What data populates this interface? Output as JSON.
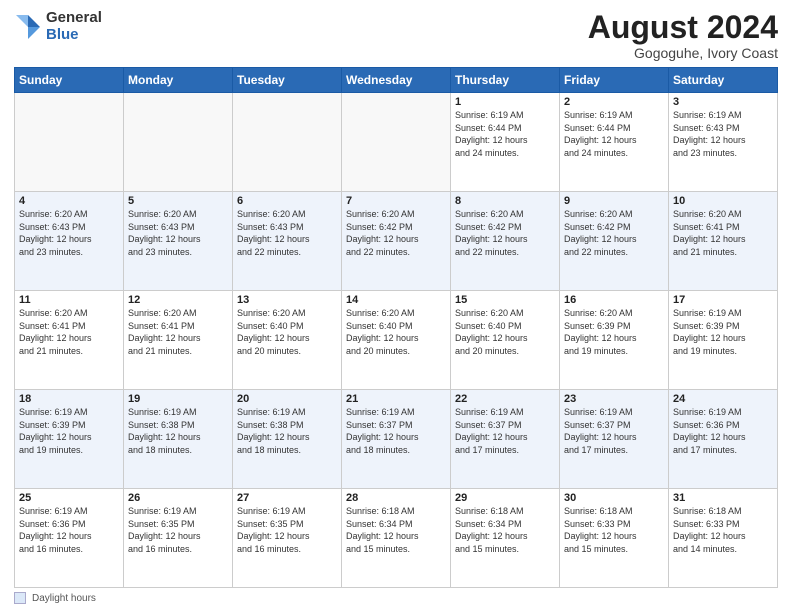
{
  "logo": {
    "general": "General",
    "blue": "Blue"
  },
  "title": "August 2024",
  "subtitle": "Gogoguhe, Ivory Coast",
  "days_of_week": [
    "Sunday",
    "Monday",
    "Tuesday",
    "Wednesday",
    "Thursday",
    "Friday",
    "Saturday"
  ],
  "footer_label": "Daylight hours",
  "weeks": [
    [
      {
        "num": "",
        "info": ""
      },
      {
        "num": "",
        "info": ""
      },
      {
        "num": "",
        "info": ""
      },
      {
        "num": "",
        "info": ""
      },
      {
        "num": "1",
        "info": "Sunrise: 6:19 AM\nSunset: 6:44 PM\nDaylight: 12 hours\nand 24 minutes."
      },
      {
        "num": "2",
        "info": "Sunrise: 6:19 AM\nSunset: 6:44 PM\nDaylight: 12 hours\nand 24 minutes."
      },
      {
        "num": "3",
        "info": "Sunrise: 6:19 AM\nSunset: 6:43 PM\nDaylight: 12 hours\nand 23 minutes."
      }
    ],
    [
      {
        "num": "4",
        "info": "Sunrise: 6:20 AM\nSunset: 6:43 PM\nDaylight: 12 hours\nand 23 minutes."
      },
      {
        "num": "5",
        "info": "Sunrise: 6:20 AM\nSunset: 6:43 PM\nDaylight: 12 hours\nand 23 minutes."
      },
      {
        "num": "6",
        "info": "Sunrise: 6:20 AM\nSunset: 6:43 PM\nDaylight: 12 hours\nand 22 minutes."
      },
      {
        "num": "7",
        "info": "Sunrise: 6:20 AM\nSunset: 6:42 PM\nDaylight: 12 hours\nand 22 minutes."
      },
      {
        "num": "8",
        "info": "Sunrise: 6:20 AM\nSunset: 6:42 PM\nDaylight: 12 hours\nand 22 minutes."
      },
      {
        "num": "9",
        "info": "Sunrise: 6:20 AM\nSunset: 6:42 PM\nDaylight: 12 hours\nand 22 minutes."
      },
      {
        "num": "10",
        "info": "Sunrise: 6:20 AM\nSunset: 6:41 PM\nDaylight: 12 hours\nand 21 minutes."
      }
    ],
    [
      {
        "num": "11",
        "info": "Sunrise: 6:20 AM\nSunset: 6:41 PM\nDaylight: 12 hours\nand 21 minutes."
      },
      {
        "num": "12",
        "info": "Sunrise: 6:20 AM\nSunset: 6:41 PM\nDaylight: 12 hours\nand 21 minutes."
      },
      {
        "num": "13",
        "info": "Sunrise: 6:20 AM\nSunset: 6:40 PM\nDaylight: 12 hours\nand 20 minutes."
      },
      {
        "num": "14",
        "info": "Sunrise: 6:20 AM\nSunset: 6:40 PM\nDaylight: 12 hours\nand 20 minutes."
      },
      {
        "num": "15",
        "info": "Sunrise: 6:20 AM\nSunset: 6:40 PM\nDaylight: 12 hours\nand 20 minutes."
      },
      {
        "num": "16",
        "info": "Sunrise: 6:20 AM\nSunset: 6:39 PM\nDaylight: 12 hours\nand 19 minutes."
      },
      {
        "num": "17",
        "info": "Sunrise: 6:19 AM\nSunset: 6:39 PM\nDaylight: 12 hours\nand 19 minutes."
      }
    ],
    [
      {
        "num": "18",
        "info": "Sunrise: 6:19 AM\nSunset: 6:39 PM\nDaylight: 12 hours\nand 19 minutes."
      },
      {
        "num": "19",
        "info": "Sunrise: 6:19 AM\nSunset: 6:38 PM\nDaylight: 12 hours\nand 18 minutes."
      },
      {
        "num": "20",
        "info": "Sunrise: 6:19 AM\nSunset: 6:38 PM\nDaylight: 12 hours\nand 18 minutes."
      },
      {
        "num": "21",
        "info": "Sunrise: 6:19 AM\nSunset: 6:37 PM\nDaylight: 12 hours\nand 18 minutes."
      },
      {
        "num": "22",
        "info": "Sunrise: 6:19 AM\nSunset: 6:37 PM\nDaylight: 12 hours\nand 17 minutes."
      },
      {
        "num": "23",
        "info": "Sunrise: 6:19 AM\nSunset: 6:37 PM\nDaylight: 12 hours\nand 17 minutes."
      },
      {
        "num": "24",
        "info": "Sunrise: 6:19 AM\nSunset: 6:36 PM\nDaylight: 12 hours\nand 17 minutes."
      }
    ],
    [
      {
        "num": "25",
        "info": "Sunrise: 6:19 AM\nSunset: 6:36 PM\nDaylight: 12 hours\nand 16 minutes."
      },
      {
        "num": "26",
        "info": "Sunrise: 6:19 AM\nSunset: 6:35 PM\nDaylight: 12 hours\nand 16 minutes."
      },
      {
        "num": "27",
        "info": "Sunrise: 6:19 AM\nSunset: 6:35 PM\nDaylight: 12 hours\nand 16 minutes."
      },
      {
        "num": "28",
        "info": "Sunrise: 6:18 AM\nSunset: 6:34 PM\nDaylight: 12 hours\nand 15 minutes."
      },
      {
        "num": "29",
        "info": "Sunrise: 6:18 AM\nSunset: 6:34 PM\nDaylight: 12 hours\nand 15 minutes."
      },
      {
        "num": "30",
        "info": "Sunrise: 6:18 AM\nSunset: 6:33 PM\nDaylight: 12 hours\nand 15 minutes."
      },
      {
        "num": "31",
        "info": "Sunrise: 6:18 AM\nSunset: 6:33 PM\nDaylight: 12 hours\nand 14 minutes."
      }
    ]
  ]
}
